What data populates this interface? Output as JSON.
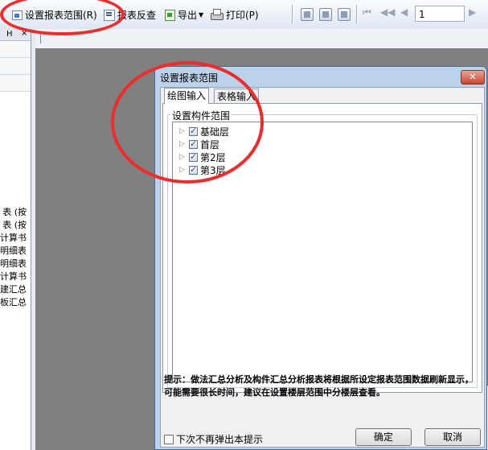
{
  "toolbar": {
    "set_range_label": "设置报表范围(R)",
    "report_check_label": "报表反查",
    "export_label": "导出",
    "print_label": "打印(P)",
    "page_value": "1",
    "icons": {
      "set_range": "report-range-icon",
      "report_check": "report-check-icon",
      "export": "export-icon",
      "print": "printer-icon"
    }
  },
  "left_panel": {
    "tab_label": "H",
    "close_label": "×",
    "items": [
      "表 (按",
      "表 (按",
      "计算书",
      "明细表",
      "明细表",
      "计算书",
      "建汇总",
      "板汇总"
    ]
  },
  "dialog": {
    "title": "设置报表范围",
    "close_label": "✕",
    "tabs": [
      "绘图输入",
      "表格输入"
    ],
    "group_title": "设置构件范围",
    "tree": [
      {
        "label": "基础层",
        "checked": true
      },
      {
        "label": "首层",
        "checked": true
      },
      {
        "label": "第2层",
        "checked": true
      },
      {
        "label": "第3层",
        "checked": true
      }
    ],
    "hint": "提示：做法汇总分析及构件汇总分析报表将根据所设定报表范围数据刷新显示，可能需要很长时间，建议在设置楼层范围中分楼层查看。",
    "dont_show_label": "下次不再弹出本提示",
    "ok_label": "确定",
    "cancel_label": "取消"
  },
  "colors": {
    "annotation": "#ec2d2d",
    "dialog_frame": "#bcd2ea",
    "workspace": "#808080"
  }
}
